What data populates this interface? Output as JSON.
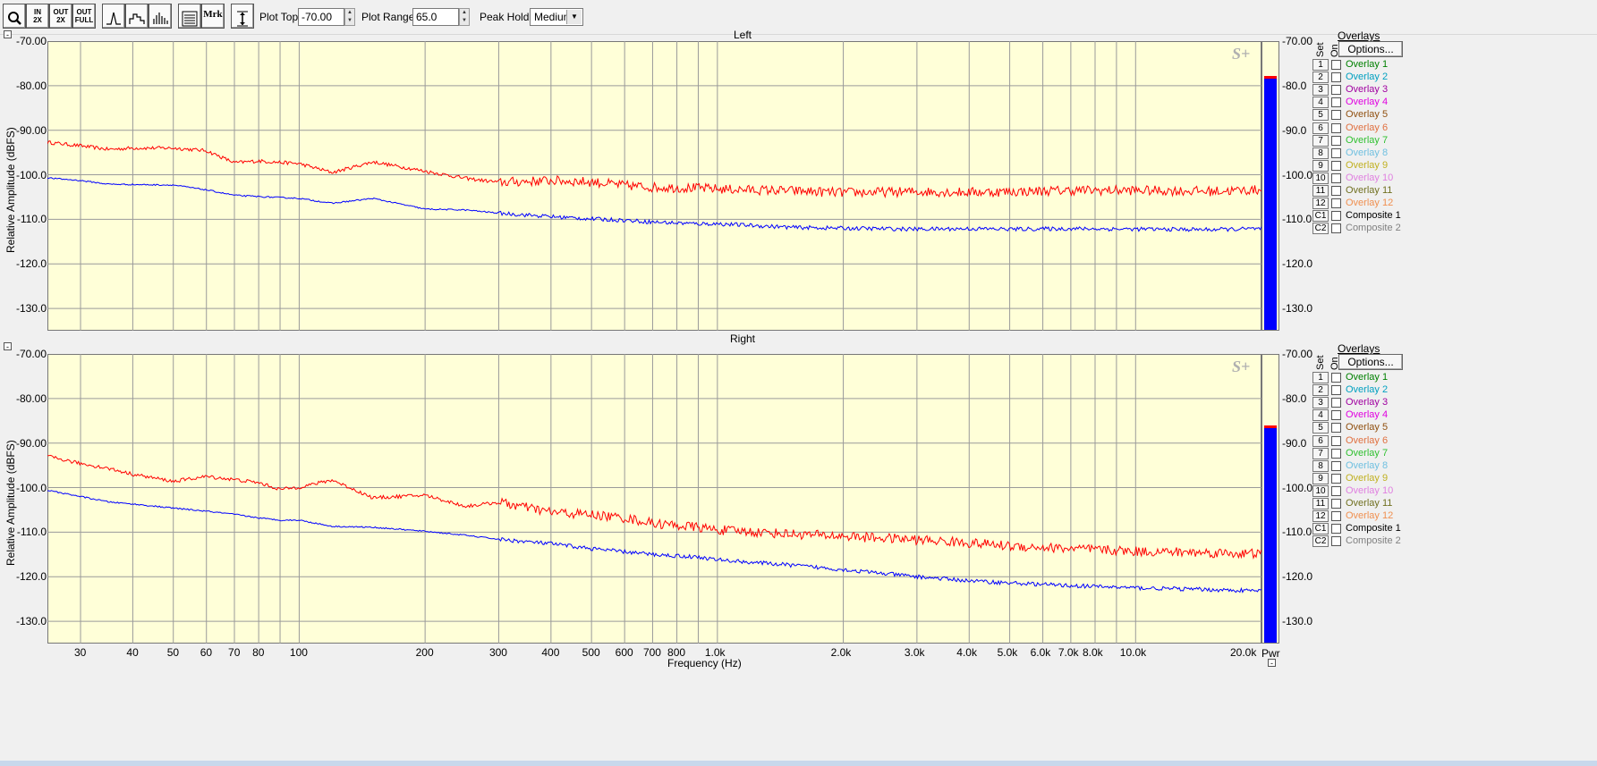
{
  "toolbar": {
    "buttons": [
      {
        "name": "zoom-button",
        "label": ""
      },
      {
        "name": "zoom-in-2x-button",
        "label": "IN\n2X"
      },
      {
        "name": "zoom-out-2x-button",
        "label": "OUT\n2X"
      },
      {
        "name": "zoom-out-full-button",
        "label": "OUT\nFULL"
      },
      {
        "name": "line-plot-button",
        "label": ""
      },
      {
        "name": "step-plot-button",
        "label": ""
      },
      {
        "name": "bar-plot-button",
        "label": ""
      },
      {
        "name": "list-view-button",
        "label": ""
      },
      {
        "name": "marker-button",
        "label": "Mrk"
      },
      {
        "name": "cursor-button",
        "label": ""
      }
    ],
    "plot_top_label": "Plot Top:",
    "plot_top_value": "-70.00",
    "plot_range_label": "Plot Range:",
    "plot_range_value": "65.0",
    "peak_hold_label": "Peak Hold:",
    "peak_hold_value": "Medium"
  },
  "colors": {
    "plot_bg": "#ffffd8",
    "red_trace": "#ff0000",
    "blue_trace": "#0000ff",
    "grid": "#9a9a9a"
  },
  "overlays": {
    "title": "Overlays",
    "options_label": "Options...",
    "set_header": "Set",
    "on_header": "On",
    "items": [
      {
        "num": "1",
        "name": "Overlay 1",
        "color": "#008000"
      },
      {
        "num": "2",
        "name": "Overlay 2",
        "color": "#00a0c0"
      },
      {
        "num": "3",
        "name": "Overlay 3",
        "color": "#a000a0"
      },
      {
        "num": "4",
        "name": "Overlay 4",
        "color": "#e000e0"
      },
      {
        "num": "5",
        "name": "Overlay 5",
        "color": "#905010"
      },
      {
        "num": "6",
        "name": "Overlay 6",
        "color": "#e07040"
      },
      {
        "num": "7",
        "name": "Overlay 7",
        "color": "#30c030"
      },
      {
        "num": "8",
        "name": "Overlay 8",
        "color": "#70c0e0"
      },
      {
        "num": "9",
        "name": "Overlay 9",
        "color": "#c0b020"
      },
      {
        "num": "10",
        "name": "Overlay 10",
        "color": "#e080e0"
      },
      {
        "num": "11",
        "name": "Overlay 11",
        "color": "#707020"
      },
      {
        "num": "12",
        "name": "Overlay 12",
        "color": "#f09050"
      },
      {
        "num": "C1",
        "name": "Composite 1",
        "color": "#000000"
      },
      {
        "num": "C2",
        "name": "Composite 2",
        "color": "#808080"
      }
    ]
  },
  "meter": {
    "ticks": [
      "-70.00",
      "-80.0",
      "-90.0",
      "-100.0",
      "-110.0",
      "-120.0",
      "-130.0"
    ],
    "footer": "Pwr"
  },
  "chart_data": [
    {
      "type": "line",
      "title": "Left",
      "xlabel": "Frequency (Hz)",
      "ylabel": "Relative Amplitude (dBFS)",
      "xscale": "log",
      "xlim": [
        25,
        20000
      ],
      "ylim": [
        -135,
        -70
      ],
      "grid": true,
      "yticks": [
        "-70.00",
        "-80.00",
        "-90.00",
        "-100.0",
        "-110.0",
        "-120.0",
        "-130.0"
      ],
      "xticks": [
        "30",
        "40",
        "50",
        "60",
        "70",
        "80",
        "100",
        "200",
        "300",
        "400",
        "500",
        "600",
        "700",
        "800",
        "1.0k",
        "2.0k",
        "3.0k",
        "4.0k",
        "5.0k",
        "6.0k",
        "7.0k",
        "8.0k",
        "10.0k",
        "20.0k"
      ],
      "series": [
        {
          "color": "#ff0000",
          "x": [
            25,
            30,
            35,
            40,
            50,
            60,
            70,
            80,
            100,
            120,
            150,
            200,
            250,
            300,
            400,
            500,
            600,
            700,
            900,
            1000,
            1500,
            2000,
            3000,
            4000,
            5000,
            7000,
            10000,
            15000,
            20000
          ],
          "y": [
            -92.7,
            -93.5,
            -94.3,
            -94.0,
            -94.0,
            -94.6,
            -97.3,
            -96.9,
            -97.5,
            -99.5,
            -97.1,
            -99.2,
            -100.8,
            -101.7,
            -101.3,
            -101.6,
            -102.4,
            -102.8,
            -103.0,
            -103.2,
            -103.6,
            -104.0,
            -103.8,
            -103.9,
            -103.8,
            -103.5,
            -103.5,
            -103.7,
            -103.4
          ]
        },
        {
          "color": "#0000ff",
          "x": [
            25,
            30,
            35,
            40,
            50,
            60,
            70,
            80,
            100,
            120,
            150,
            200,
            250,
            300,
            400,
            500,
            600,
            700,
            900,
            1000,
            1500,
            2000,
            3000,
            4000,
            5000,
            7000,
            10000,
            15000,
            20000
          ],
          "y": [
            -100.7,
            -101.3,
            -102.1,
            -102.2,
            -102.3,
            -103.4,
            -104.6,
            -104.9,
            -105.3,
            -106.4,
            -105.3,
            -107.7,
            -107.9,
            -108.6,
            -109.4,
            -109.9,
            -110.2,
            -110.6,
            -111.0,
            -111.0,
            -111.8,
            -112.0,
            -112.2,
            -112.1,
            -112.2,
            -112.1,
            -112.2,
            -112.3,
            -112.1
          ]
        }
      ]
    },
    {
      "type": "line",
      "title": "Right",
      "xlabel": "Frequency (Hz)",
      "ylabel": "Relative Amplitude (dBFS)",
      "xscale": "log",
      "xlim": [
        25,
        20000
      ],
      "ylim": [
        -135,
        -70
      ],
      "grid": true,
      "yticks": [
        "-70.00",
        "-80.00",
        "-90.00",
        "-100.0",
        "-110.0",
        "-120.0",
        "-130.0"
      ],
      "xticks": [
        "30",
        "40",
        "50",
        "60",
        "70",
        "80",
        "100",
        "200",
        "300",
        "400",
        "500",
        "600",
        "700",
        "800",
        "1.0k",
        "2.0k",
        "3.0k",
        "4.0k",
        "5.0k",
        "6.0k",
        "7.0k",
        "8.0k",
        "10.0k",
        "20.0k"
      ],
      "series": [
        {
          "color": "#ff0000",
          "x": [
            25,
            30,
            35,
            40,
            50,
            60,
            70,
            80,
            90,
            100,
            120,
            150,
            200,
            250,
            300,
            400,
            500,
            600,
            700,
            900,
            1000,
            1500,
            2000,
            3000,
            4000,
            5000,
            7000,
            10000,
            15000,
            20000
          ],
          "y": [
            -93.0,
            -94.6,
            -95.7,
            -97.0,
            -98.6,
            -97.5,
            -98.2,
            -98.9,
            -100.4,
            -99.9,
            -98.3,
            -102.3,
            -101.7,
            -104.2,
            -103.3,
            -105.5,
            -106.1,
            -106.8,
            -108.0,
            -108.9,
            -109.5,
            -110.4,
            -110.9,
            -111.7,
            -112.4,
            -113.1,
            -113.7,
            -114.3,
            -114.6,
            -114.9
          ]
        },
        {
          "color": "#0000ff",
          "x": [
            25,
            30,
            35,
            40,
            50,
            60,
            70,
            80,
            90,
            100,
            120,
            150,
            200,
            250,
            300,
            400,
            500,
            600,
            700,
            900,
            1000,
            1500,
            2000,
            3000,
            4000,
            5000,
            7000,
            10000,
            15000,
            20000
          ],
          "y": [
            -100.6,
            -102.0,
            -103.2,
            -103.7,
            -104.6,
            -105.3,
            -106.0,
            -106.8,
            -107.3,
            -107.3,
            -108.7,
            -108.9,
            -109.8,
            -110.7,
            -111.6,
            -112.6,
            -113.7,
            -114.4,
            -115.0,
            -115.6,
            -116.2,
            -117.4,
            -118.4,
            -120.0,
            -120.9,
            -121.4,
            -122.0,
            -122.5,
            -122.9,
            -123.2
          ]
        }
      ]
    }
  ],
  "meters": [
    {
      "name": "left-level-meter",
      "level_db": -78.0
    },
    {
      "name": "right-level-meter",
      "level_db": -86.4
    }
  ]
}
